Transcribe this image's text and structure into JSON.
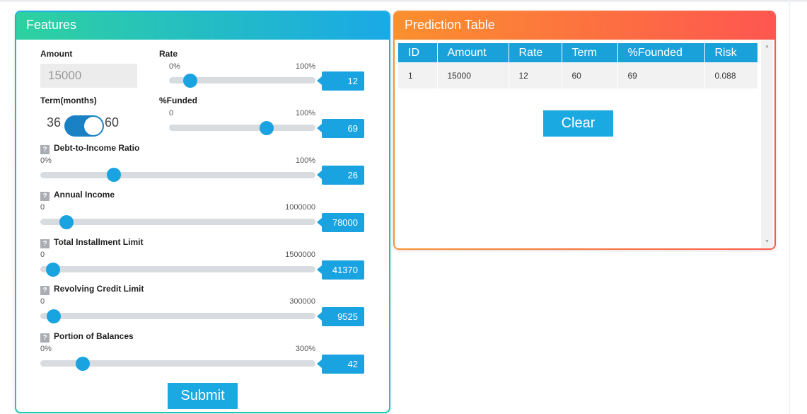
{
  "features": {
    "title": "Features",
    "amount": {
      "label": "Amount",
      "value": "15000"
    },
    "rate": {
      "label": "Rate",
      "min": "0%",
      "max": "100%",
      "value": "12",
      "fraction": 0.12
    },
    "term": {
      "label": "Term(months)",
      "option_left": "36",
      "option_right": "60",
      "selected": "60"
    },
    "funded": {
      "label": "%Funded",
      "min": "0",
      "max": "100%",
      "value": "69",
      "fraction": 0.69
    },
    "dti": {
      "label": "Debt-to-Income Ratio",
      "min": "0%",
      "max": "100%",
      "value": "26",
      "fraction": 0.26
    },
    "income": {
      "label": "Annual Income",
      "min": "0",
      "max": "1000000",
      "value": "78000",
      "fraction": 0.078
    },
    "installment": {
      "label": "Total Installment Limit",
      "min": "0",
      "max": "1500000",
      "value": "41370",
      "fraction": 0.0276
    },
    "revolving": {
      "label": "Revolving Credit Limit",
      "min": "0",
      "max": "300000",
      "value": "9525",
      "fraction": 0.0318
    },
    "balances": {
      "label": "Portion of Balances",
      "min": "0%",
      "max": "300%",
      "value": "42",
      "fraction": 0.14
    },
    "help_glyph": "?",
    "submit_label": "Submit"
  },
  "prediction": {
    "title": "Prediction Table",
    "columns": [
      "ID",
      "Amount",
      "Rate",
      "Term",
      "%Founded",
      "Risk"
    ],
    "rows": [
      [
        "1",
        "15000",
        "12",
        "60",
        "69",
        "0.088"
      ]
    ],
    "clear_label": "Clear",
    "scroll_up": "▲",
    "scroll_down": "▼"
  },
  "colors": {
    "accent": "#1aa3e1",
    "features_gradient": [
      "#2ed1a0",
      "#1aa9e6"
    ],
    "prediction_gradient": [
      "#fb8f2e",
      "#fe5650"
    ]
  }
}
